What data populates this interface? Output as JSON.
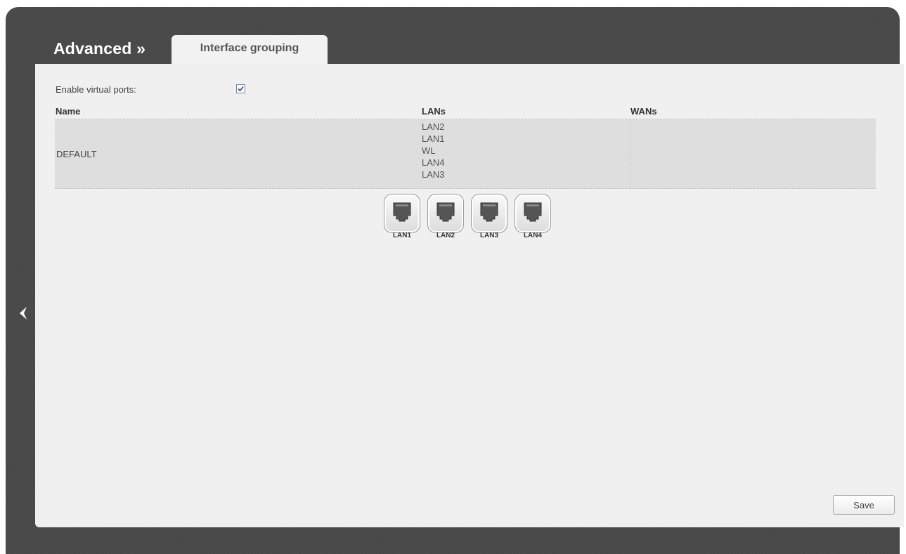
{
  "header": {
    "breadcrumb": "Advanced »",
    "tab": "Interface grouping"
  },
  "settings": {
    "virtual_ports_label": "Enable virtual ports:",
    "virtual_ports_checked": true
  },
  "table": {
    "columns": [
      "Name",
      "LANs",
      "WANs"
    ],
    "rows": [
      {
        "name": "DEFAULT",
        "lans": [
          "LAN2",
          "LAN1",
          "WL",
          "LAN4",
          "LAN3"
        ],
        "wans": []
      }
    ]
  },
  "ports": [
    {
      "label": "LAN1",
      "icon": "ethernet-port-icon"
    },
    {
      "label": "LAN2",
      "icon": "ethernet-port-icon"
    },
    {
      "label": "LAN3",
      "icon": "ethernet-port-icon"
    },
    {
      "label": "LAN4",
      "icon": "ethernet-port-icon"
    }
  ],
  "actions": {
    "save_label": "Save"
  },
  "icons": {
    "back": "back-arrow-icon"
  },
  "colors": {
    "frame": "#4a4a4a",
    "panel": "#f1f1f1",
    "row": "#dedede"
  }
}
